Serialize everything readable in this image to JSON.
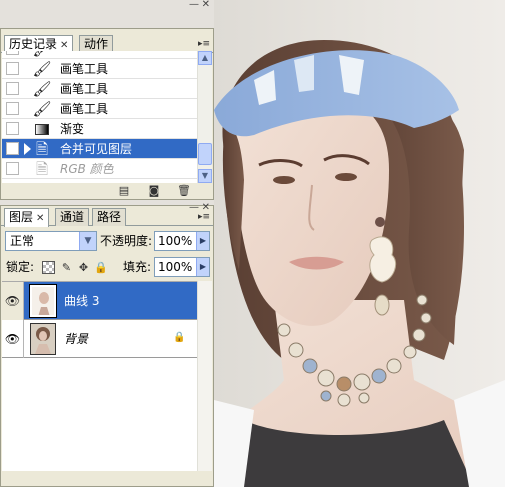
{
  "history_panel": {
    "tabs": [
      {
        "label": "历史记录",
        "active": true
      },
      {
        "label": "动作",
        "active": false
      }
    ],
    "items": [
      {
        "label": "画笔工具",
        "icon": "brush-icon",
        "selected": false,
        "dim": false
      },
      {
        "label": "画笔工具",
        "icon": "brush-icon",
        "selected": false,
        "dim": false
      },
      {
        "label": "画笔工具",
        "icon": "brush-icon",
        "selected": false,
        "dim": false
      },
      {
        "label": "渐变",
        "icon": "gradient-icon",
        "selected": false,
        "dim": false
      },
      {
        "label": "合并可见图层",
        "icon": "document-icon",
        "selected": true,
        "dim": false
      },
      {
        "label": "RGB 颜色",
        "icon": "document-icon",
        "selected": false,
        "dim": true
      }
    ],
    "footer_icons": [
      "new-document-from-state-icon",
      "new-snapshot-icon",
      "delete-state-icon"
    ]
  },
  "layers_panel": {
    "tabs": [
      {
        "label": "图层",
        "active": true
      },
      {
        "label": "通道",
        "active": false
      },
      {
        "label": "路径",
        "active": false
      }
    ],
    "blend_mode": "正常",
    "opacity_label": "不透明度:",
    "opacity_value": "100%",
    "lock_label": "锁定:",
    "fill_label": "填充:",
    "fill_value": "100%",
    "layers": [
      {
        "name": "曲线 3",
        "selected": true,
        "visible": true,
        "locked": false
      },
      {
        "name": "背景",
        "selected": false,
        "visible": true,
        "locked": true
      }
    ]
  },
  "colors": {
    "selection": "#316ac5",
    "panel_bg": "#ece9d8",
    "scroll_blue": "#c1d3fb"
  }
}
